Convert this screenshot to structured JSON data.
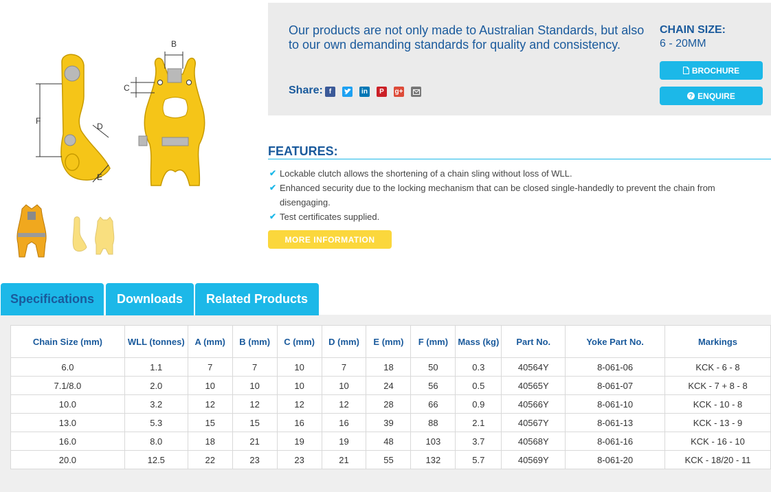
{
  "intro_text": "Our products are not only made to Australian Standards, but also to our own demanding standards for quality and consistency.",
  "share": {
    "label": "Share:",
    "icons": [
      "facebook-icon",
      "twitter-icon",
      "linkedin-icon",
      "pinterest-icon",
      "google-plus-icon",
      "email-icon"
    ]
  },
  "chain_size": {
    "title": "CHAIN SIZE:",
    "value": "6 - 20MM"
  },
  "buttons": {
    "brochure": "BROCHURE",
    "enquire": "ENQUIRE",
    "more_info": "MORE INFORMATION"
  },
  "features": {
    "title": "FEATURES:",
    "items": [
      "Lockable clutch allows the shortening of a chain sling without loss of WLL.",
      "Enhanced security due to the locking mechanism that can be closed single-handedly to prevent the chain from disengaging.",
      "Test certificates supplied."
    ]
  },
  "tabs": [
    "Specifications",
    "Downloads",
    "Related Products"
  ],
  "diagram_labels": {
    "a": "B",
    "c": "C",
    "f": "F",
    "d": "D",
    "e": "E"
  },
  "table": {
    "headers": [
      "Chain Size (mm)",
      "WLL (tonnes)",
      "A (mm)",
      "B (mm)",
      "C (mm)",
      "D (mm)",
      "E (mm)",
      "F (mm)",
      "Mass (kg)",
      "Part No.",
      "Yoke Part No.",
      "Markings"
    ],
    "rows": [
      [
        "6.0",
        "1.1",
        "7",
        "7",
        "10",
        "7",
        "18",
        "50",
        "0.3",
        "40564Y",
        "8-061-06",
        "KCK - 6 - 8"
      ],
      [
        "7.1/8.0",
        "2.0",
        "10",
        "10",
        "10",
        "10",
        "24",
        "56",
        "0.5",
        "40565Y",
        "8-061-07",
        "KCK - 7 + 8 - 8"
      ],
      [
        "10.0",
        "3.2",
        "12",
        "12",
        "12",
        "12",
        "28",
        "66",
        "0.9",
        "40566Y",
        "8-061-10",
        "KCK - 10 - 8"
      ],
      [
        "13.0",
        "5.3",
        "15",
        "15",
        "16",
        "16",
        "39",
        "88",
        "2.1",
        "40567Y",
        "8-061-13",
        "KCK - 13 - 9"
      ],
      [
        "16.0",
        "8.0",
        "18",
        "21",
        "19",
        "19",
        "48",
        "103",
        "3.7",
        "40568Y",
        "8-061-16",
        "KCK - 16 - 10"
      ],
      [
        "20.0",
        "12.5",
        "22",
        "23",
        "23",
        "21",
        "55",
        "132",
        "5.7",
        "40569Y",
        "8-061-20",
        "KCK - 18/20 - 11"
      ]
    ]
  }
}
